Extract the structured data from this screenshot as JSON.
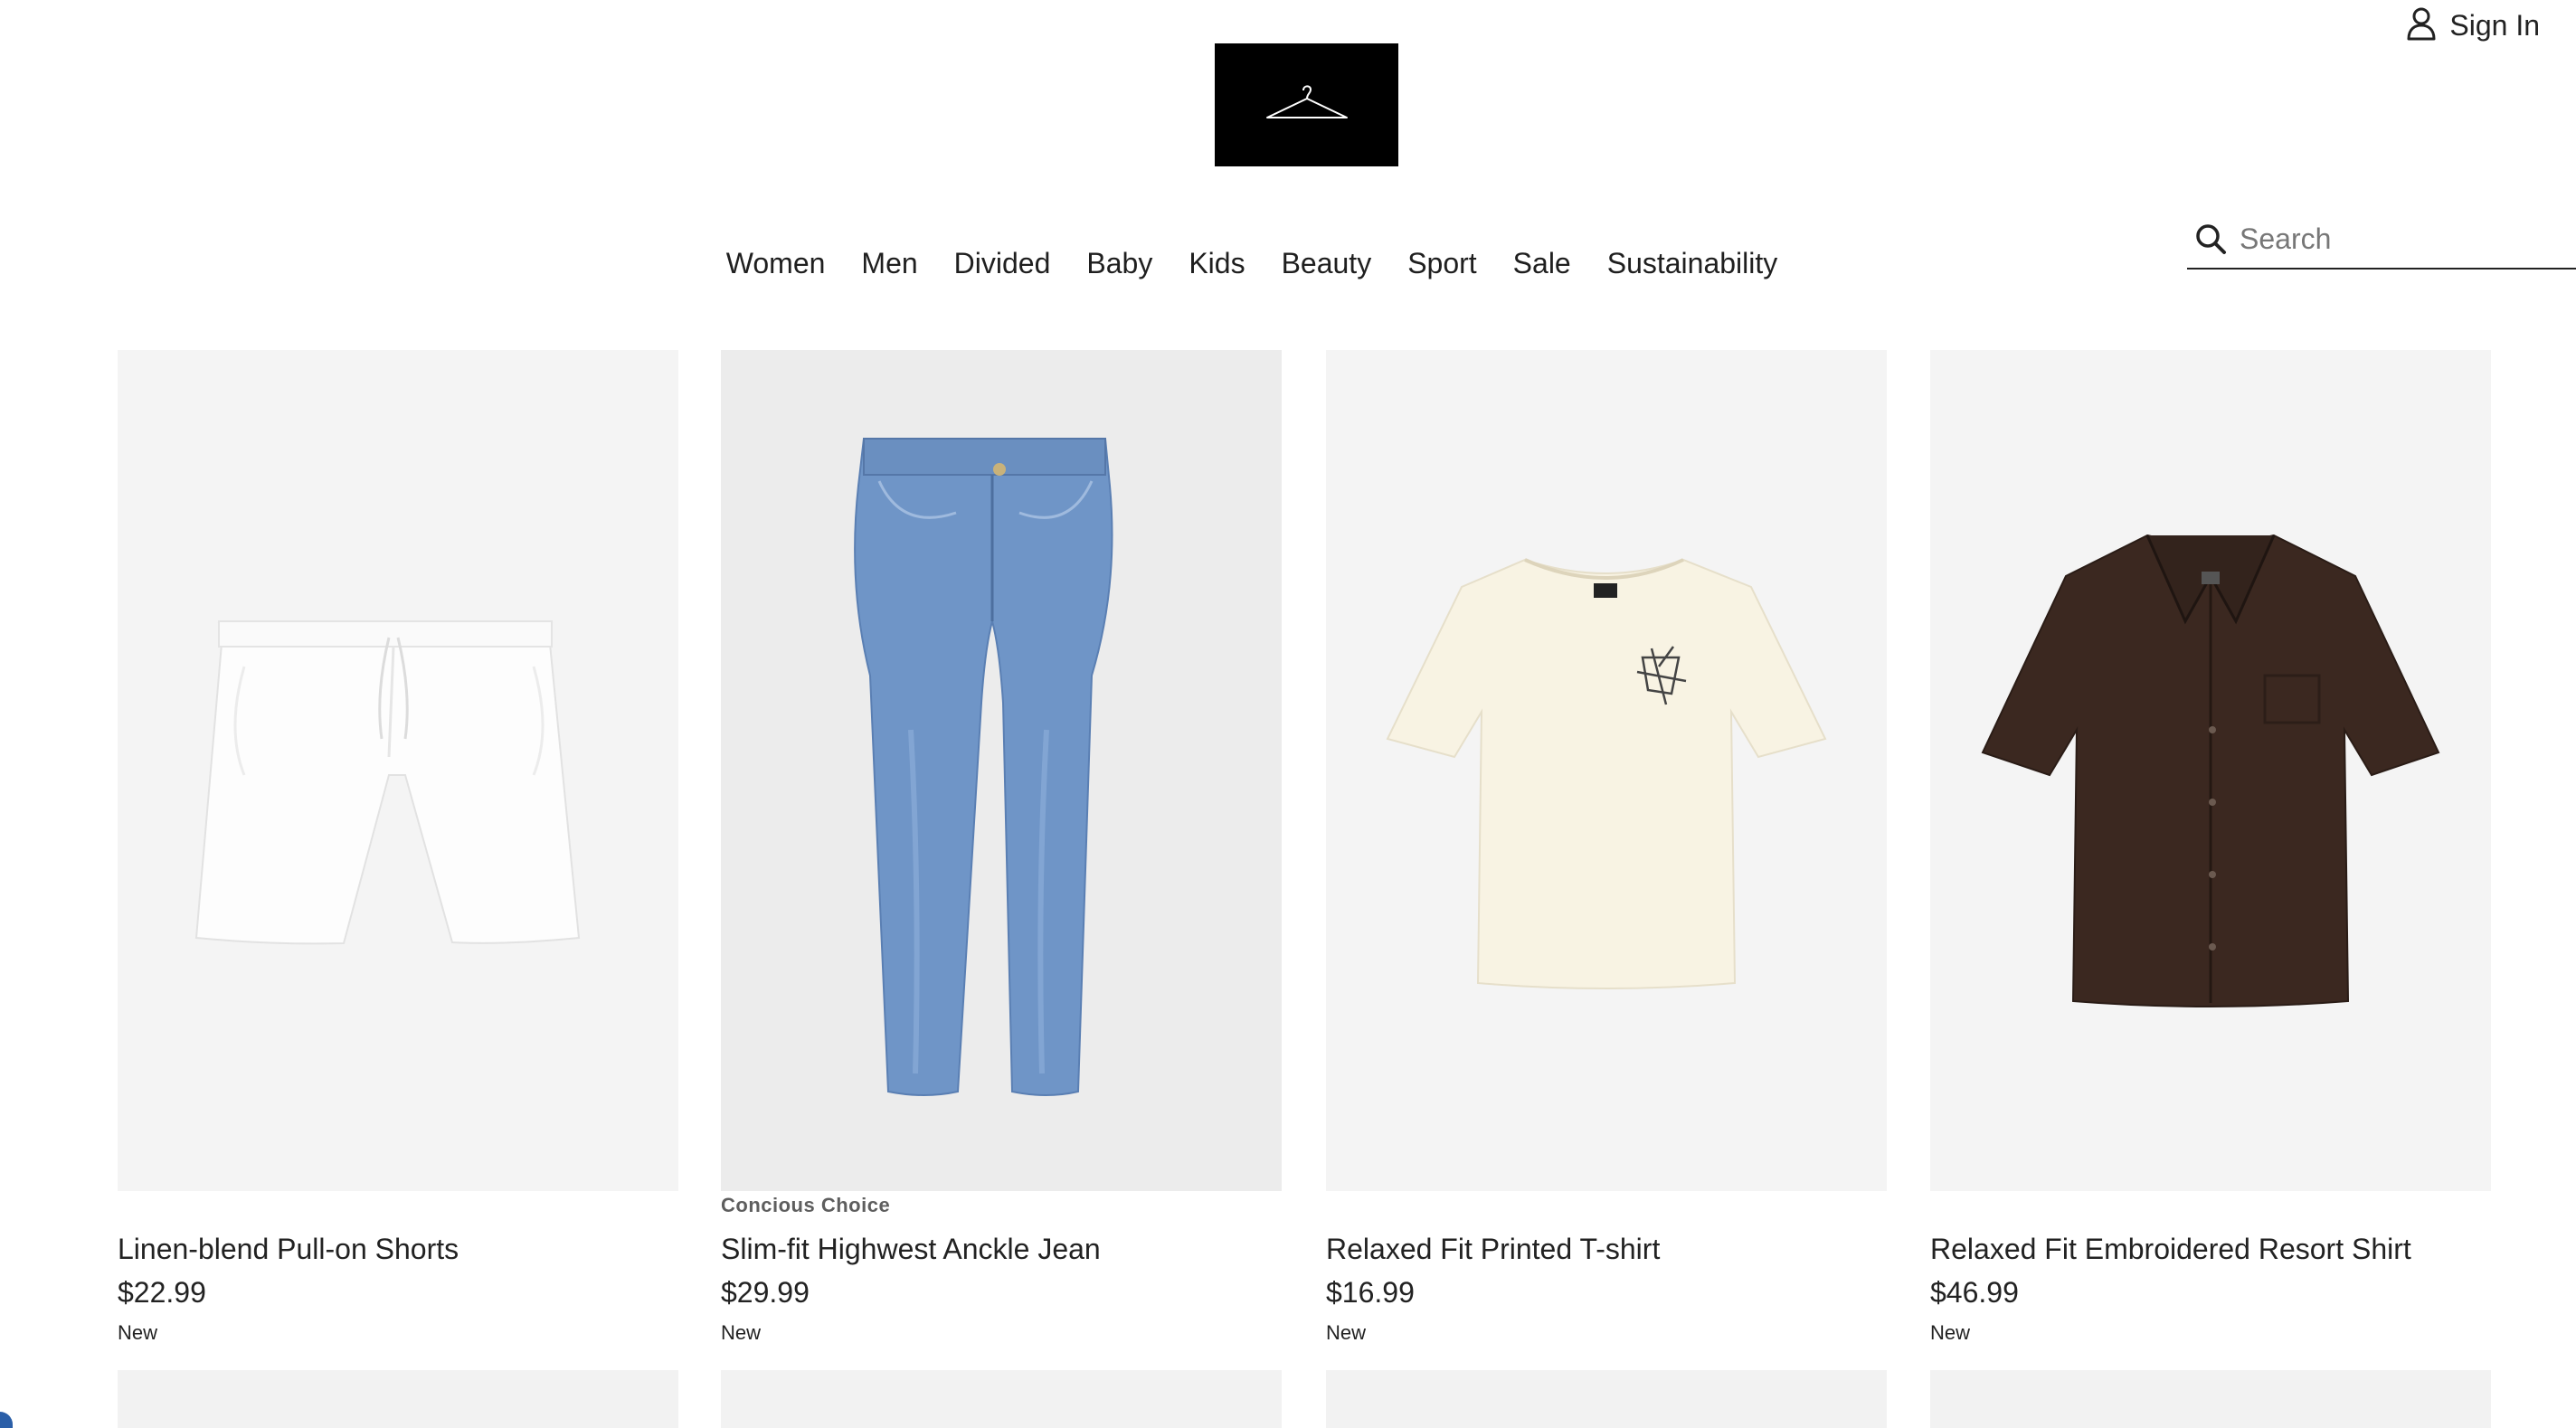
{
  "header": {
    "signin_label": "Sign In",
    "logo_icon": "clothes-hanger-icon",
    "user_icon": "user-icon"
  },
  "nav": {
    "items": [
      "Women",
      "Men",
      "Divided",
      "Baby",
      "Kids",
      "Beauty",
      "Sport",
      "Sale",
      "Sustainability"
    ]
  },
  "search": {
    "placeholder": "Search",
    "value": "",
    "icon": "search-icon"
  },
  "products": [
    {
      "name": "Linen-blend Pull-on Shorts",
      "price": "$22.99",
      "badge": "New",
      "tag": ""
    },
    {
      "name": "Slim-fit Highwest Anckle Jean",
      "price": "$29.99",
      "badge": "New",
      "tag": "Concious Choice"
    },
    {
      "name": "Relaxed Fit Printed T-shirt",
      "price": "$16.99",
      "badge": "New",
      "tag": ""
    },
    {
      "name": "Relaxed Fit Embroidered Resort Shirt",
      "price": "$46.99",
      "badge": "New",
      "tag": ""
    }
  ],
  "colors": {
    "logo_bg": "#000000",
    "image_bg": "#f4f4f4",
    "text": "#222222",
    "tag_text": "#5e5e5e"
  }
}
